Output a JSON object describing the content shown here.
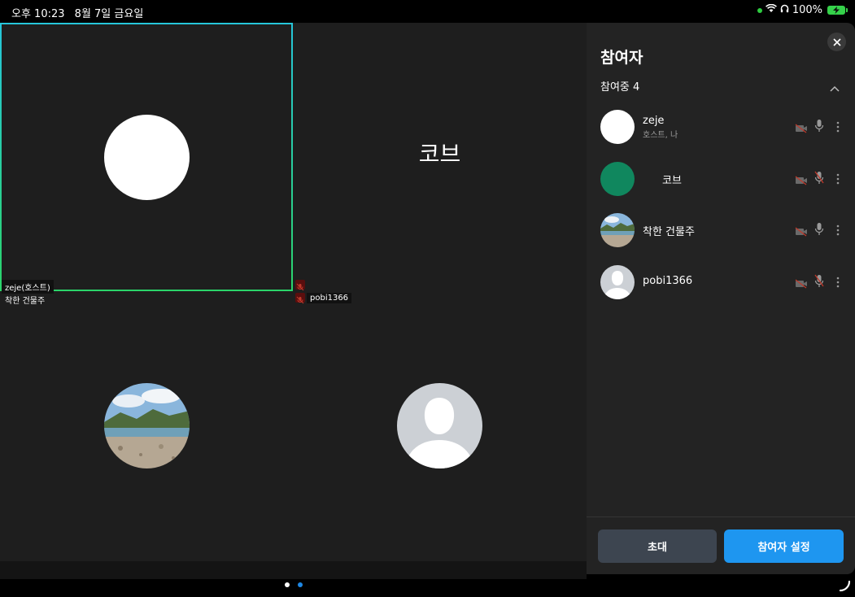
{
  "status_bar": {
    "time": "오후 10:23",
    "date": "8월 7일 금요일",
    "battery": "100%"
  },
  "grid": {
    "tiles": [
      {
        "name_label": "zeje(호스트)"
      },
      {
        "center_label": "코브"
      },
      {},
      {}
    ],
    "chips": {
      "top_left_sub": "착한 건물주",
      "pobi": "pobi1366"
    },
    "page_dots": 2,
    "active_page": 2
  },
  "panel": {
    "title": "참여자",
    "section_label": "참여중 4",
    "participants": [
      {
        "name": "zeje",
        "sub": "호스트, 나",
        "avatar": "white-circle",
        "camera": "off",
        "mic": "on"
      },
      {
        "name": "코브",
        "sub": "",
        "avatar": "green-circle",
        "camera": "off",
        "mic": "off"
      },
      {
        "name": "착한 건물주",
        "sub": "",
        "avatar": "landscape-photo",
        "camera": "off",
        "mic": "on"
      },
      {
        "name": "pobi1366",
        "sub": "",
        "avatar": "default-person",
        "camera": "off",
        "mic": "off"
      }
    ],
    "invite_label": "초대",
    "settings_label": "참여자 설정"
  },
  "colors": {
    "accent": "#1e96f0",
    "invite_bg": "#3d4550",
    "active_border_top": "#26c6da",
    "active_border_bottom": "#2bd46a",
    "green_avatar": "#10875e"
  }
}
